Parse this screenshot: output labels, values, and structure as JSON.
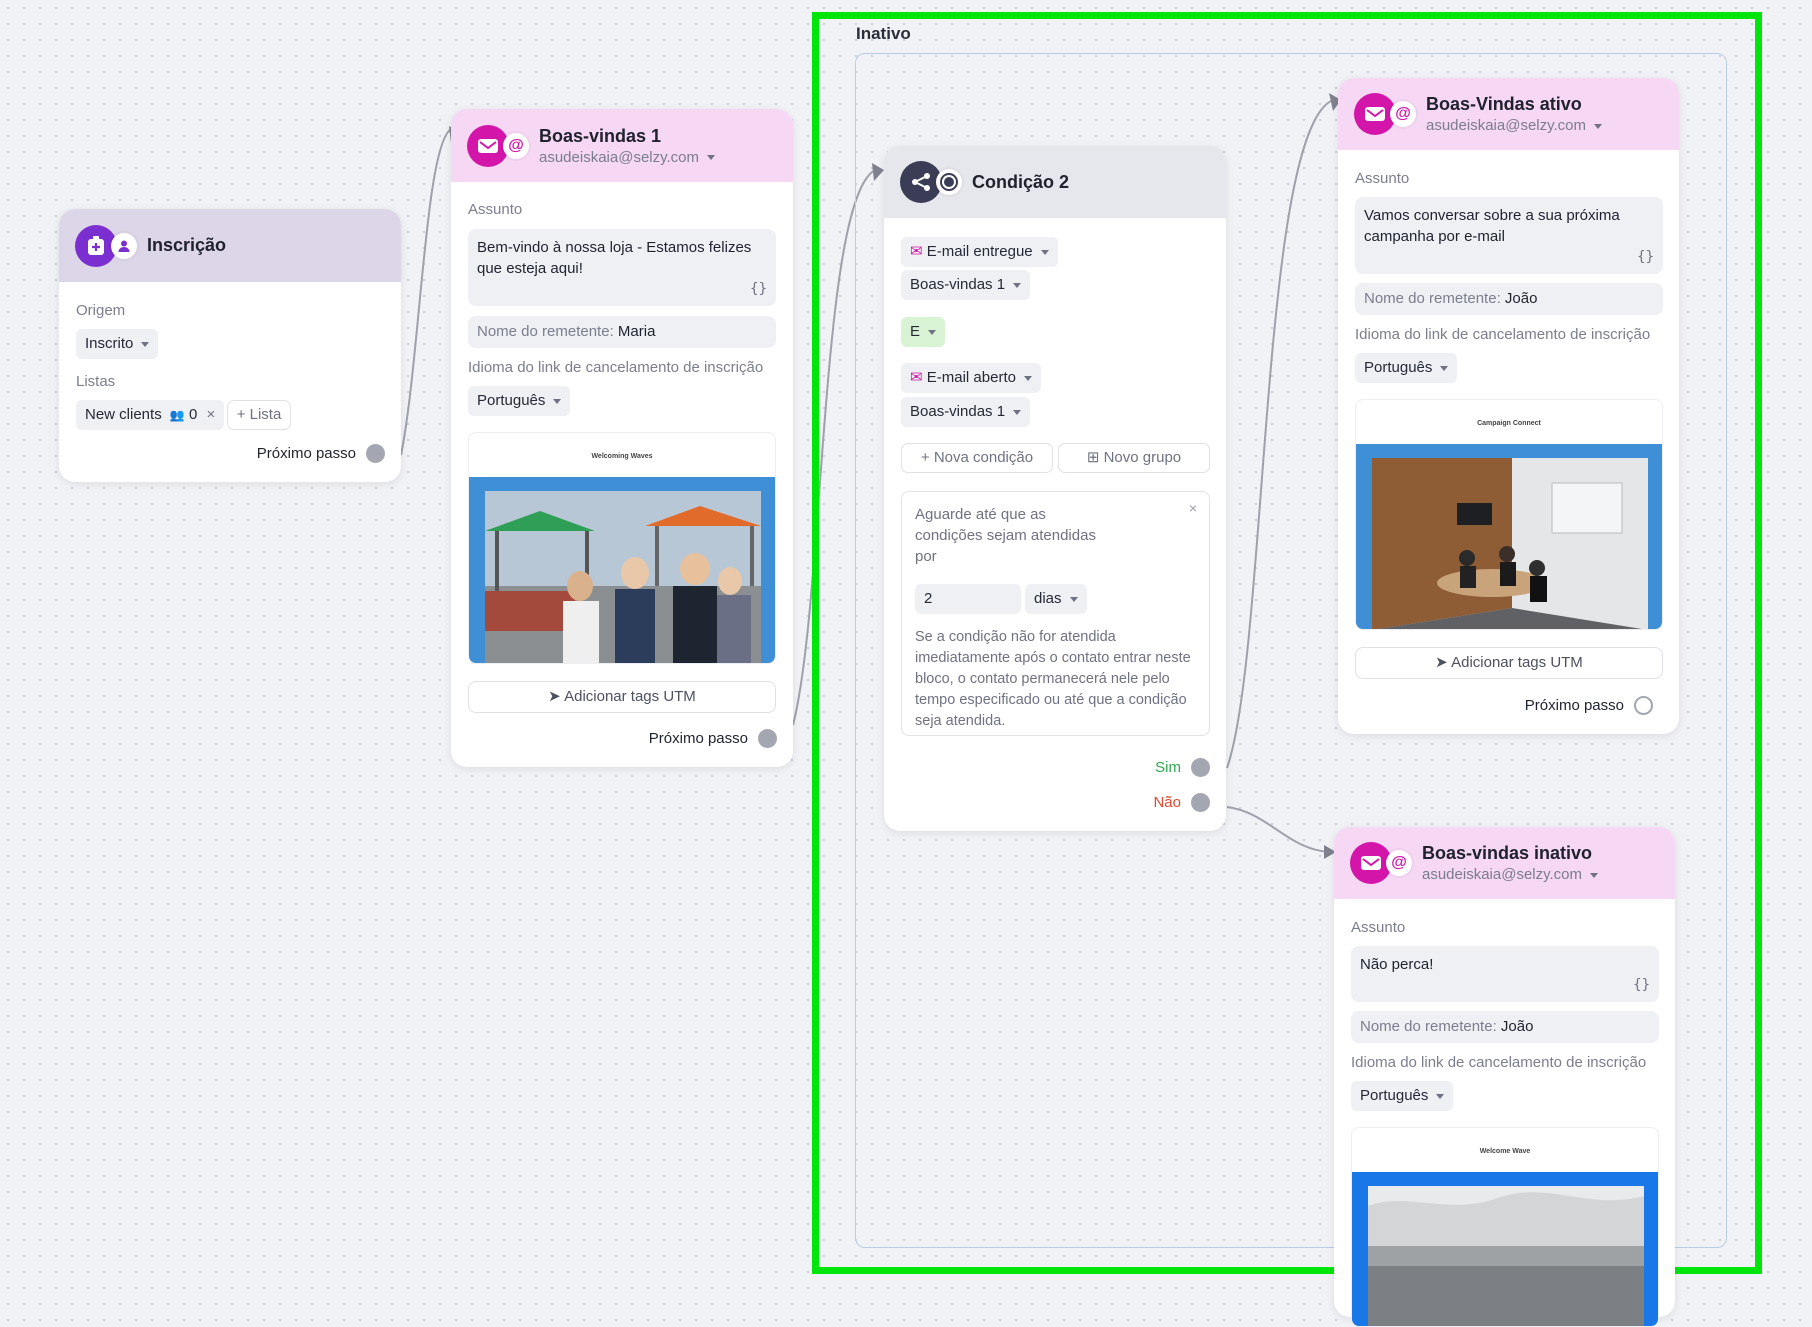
{
  "inscricao": {
    "title": "Inscrição",
    "origem_label": "Origem",
    "origem_value": "Inscrito",
    "listas_label": "Listas",
    "list_tag_name": "New clients",
    "list_tag_count": "0",
    "add_list_label": "+ Lista",
    "next_label": "Próximo passo"
  },
  "email1": {
    "title": "Boas-vindas 1",
    "sender_email": "asudeiskaia@selzy.com",
    "subject_label": "Assunto",
    "subject": "Bem-vindo à nossa loja - Estamos felizes que esteja aqui!",
    "sender_prefix": "Nome do remetente:",
    "sender_name": "Maria",
    "unsub_label": "Idioma do link de cancelamento de inscrição",
    "language": "Português",
    "preview_title": "Welcoming Waves",
    "utm_label": "Adicionar tags UTM",
    "next_label": "Próximo passo"
  },
  "group": {
    "label": "Inativo"
  },
  "condition": {
    "title": "Condição 2",
    "cond1_event": "E-mail entregue",
    "cond1_email": "Boas-vindas 1",
    "operator": "E",
    "cond2_event": "E-mail aberto",
    "cond2_email": "Boas-vindas 1",
    "new_condition": "+ Nova condição",
    "new_group": "⊞ Novo grupo",
    "wait_text": "Aguarde até que as condições sejam atendidas por",
    "wait_value": "2",
    "wait_unit": "dias",
    "wait_note": "Se a condição não for atendida imediatamente após o contato entrar neste bloco, o contato permanecerá nele pelo tempo especificado ou até que a condição seja atendida.",
    "yes_label": "Sim",
    "no_label": "Não"
  },
  "email_active": {
    "title": "Boas-Vindas ativo",
    "sender_email": "asudeiskaia@selzy.com",
    "subject_label": "Assunto",
    "subject": "Vamos conversar sobre a sua próxima campanha por e-mail",
    "sender_prefix": "Nome do remetente:",
    "sender_name": "João",
    "unsub_label": "Idioma do link de cancelamento de inscrição",
    "language": "Português",
    "preview_title": "Campaign Connect",
    "utm_label": "Adicionar tags UTM",
    "next_label": "Próximo passo"
  },
  "email_inactive": {
    "title": "Boas-vindas inativo",
    "sender_email": "asudeiskaia@selzy.com",
    "subject_label": "Assunto",
    "subject": "Não perca!",
    "sender_prefix": "Nome do remetente:",
    "sender_name": "João",
    "unsub_label": "Idioma do link de cancelamento de inscrição",
    "language": "Português",
    "preview_title": "Welcome Wave"
  },
  "colors": {
    "email_header": "#f6d7f4",
    "trigger_header": "#ddd6e8",
    "condition_header": "#e6e7ec",
    "yes": "#2fa84f",
    "no": "#e0482f",
    "highlight": "#00e60a"
  },
  "icons": {
    "email": "envelope-icon",
    "trigger": "subscribe-icon",
    "condition": "branch-icon"
  }
}
